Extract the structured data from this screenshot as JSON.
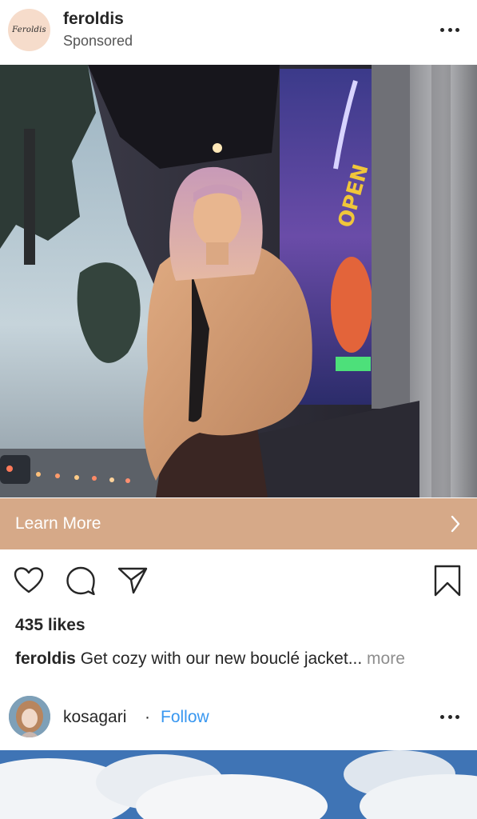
{
  "post": {
    "username": "feroldis",
    "sponsored_label": "Sponsored",
    "avatar_logo_text": "Feroldis",
    "cta_label": "Learn More",
    "likes": "435 likes",
    "caption_user": "feroldis",
    "caption_text": " Get cozy with our new bouclé jacket...",
    "caption_more": " more",
    "photo_sign_text": "OPEN"
  },
  "next_post": {
    "username": "kosagari",
    "separator": "·",
    "follow_label": "Follow"
  },
  "colors": {
    "cta_background": "#d6a988",
    "follow_blue": "#3897f0",
    "text": "#262626",
    "muted": "#8e8e8e"
  },
  "icons": {
    "menu": "more-horizontal-icon",
    "like": "heart-icon",
    "comment": "comment-icon",
    "share": "send-icon",
    "save": "bookmark-icon",
    "cta": "chevron-right-icon"
  }
}
